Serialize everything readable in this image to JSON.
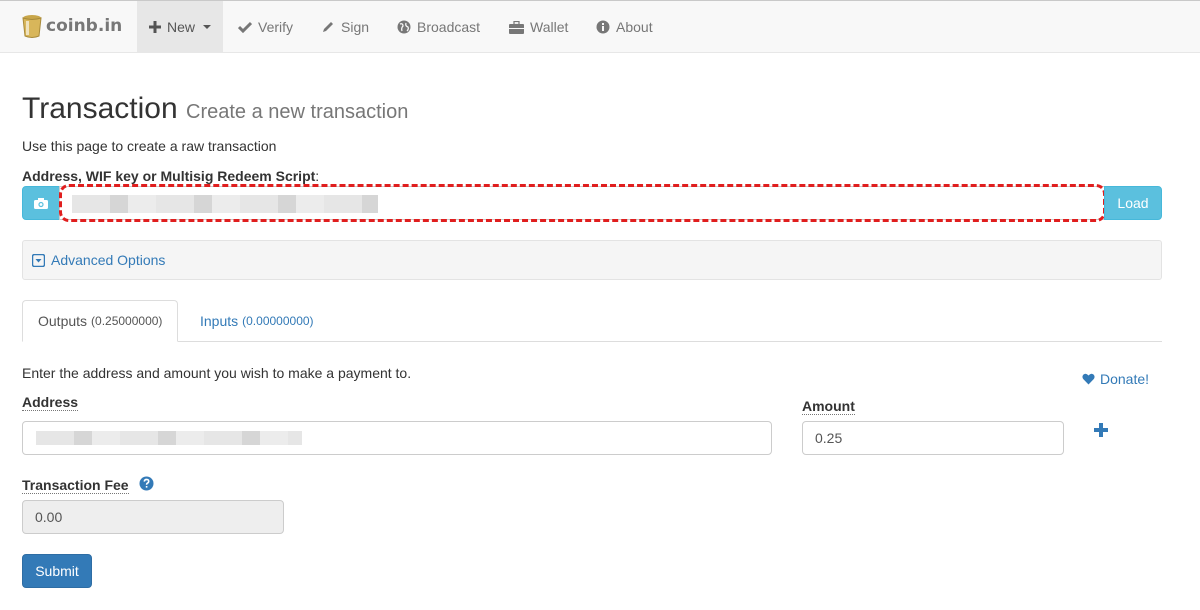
{
  "navbar": {
    "brand": "coinb.in",
    "items": [
      {
        "label": "New",
        "icon": "plus-icon",
        "active": true
      },
      {
        "label": "Verify",
        "icon": "check-icon"
      },
      {
        "label": "Sign",
        "icon": "pencil-icon"
      },
      {
        "label": "Broadcast",
        "icon": "globe-icon"
      },
      {
        "label": "Wallet",
        "icon": "briefcase-icon"
      },
      {
        "label": "About",
        "icon": "info-icon"
      }
    ]
  },
  "page": {
    "title": "Transaction",
    "subtitle": "Create a new transaction",
    "description": "Use this page to create a raw transaction"
  },
  "address_field": {
    "label": "Address, WIF key or Multisig Redeem Script",
    "label_suffix": ":",
    "value": "",
    "scan_icon": "camera-icon",
    "load_label": "Load"
  },
  "advanced": {
    "label": "Advanced Options",
    "icon": "chevron-down-square-icon"
  },
  "tabs": [
    {
      "label": "Outputs",
      "amount": "(0.25000000)",
      "active": true
    },
    {
      "label": "Inputs",
      "amount": "(0.00000000)",
      "active": false
    }
  ],
  "outputs": {
    "description": "Enter the address and amount you wish to make a payment to.",
    "donate_label": "Donate!",
    "address_label": "Address",
    "address_value": "",
    "amount_label": "Amount",
    "amount_value": "0.25"
  },
  "fee": {
    "label": "Transaction Fee",
    "value": "0.00"
  },
  "submit_label": "Submit",
  "colors": {
    "link": "#337ab7",
    "info_button": "#5bc0de",
    "primary_button": "#337ab7",
    "highlight": "#e01e1e"
  }
}
